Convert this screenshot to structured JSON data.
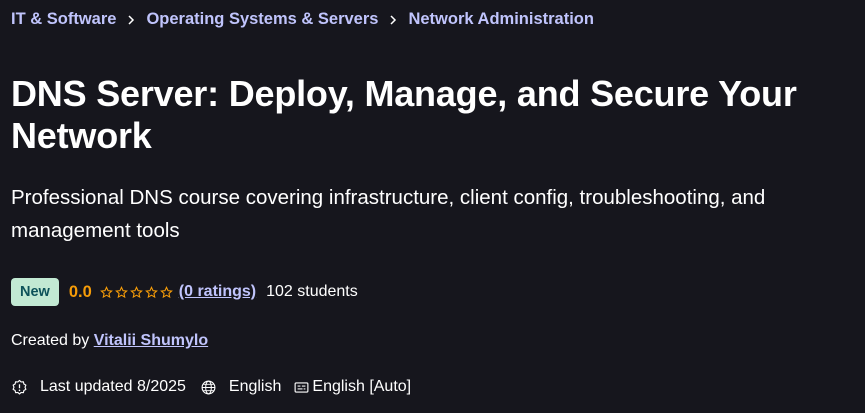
{
  "breadcrumb": {
    "items": [
      {
        "label": "IT & Software"
      },
      {
        "label": "Operating Systems & Servers"
      },
      {
        "label": "Network Administration"
      }
    ]
  },
  "course": {
    "title": "DNS Server: Deploy, Manage, and Secure Your Network",
    "subtitle": "Professional DNS course covering infrastructure, client config, troubleshooting, and management tools"
  },
  "stats": {
    "badge": "New",
    "rating": "0.0",
    "stars_filled": 0,
    "stars_total": 5,
    "ratings_link": "(0 ratings)",
    "students": "102 students"
  },
  "creator": {
    "prefix": "Created by",
    "name": "Vitalii Shumylo"
  },
  "meta": {
    "last_updated_icon": "alert-badge-icon",
    "last_updated": "Last updated 8/2025",
    "language_icon": "globe-icon",
    "language": "English",
    "captions_icon": "closed-captions-icon",
    "captions": "English [Auto]"
  },
  "colors": {
    "background": "#16161d",
    "link": "#c0c4fc",
    "rating": "#f69c08",
    "badge_bg": "#c2e9d3",
    "badge_text": "#0d5259"
  }
}
